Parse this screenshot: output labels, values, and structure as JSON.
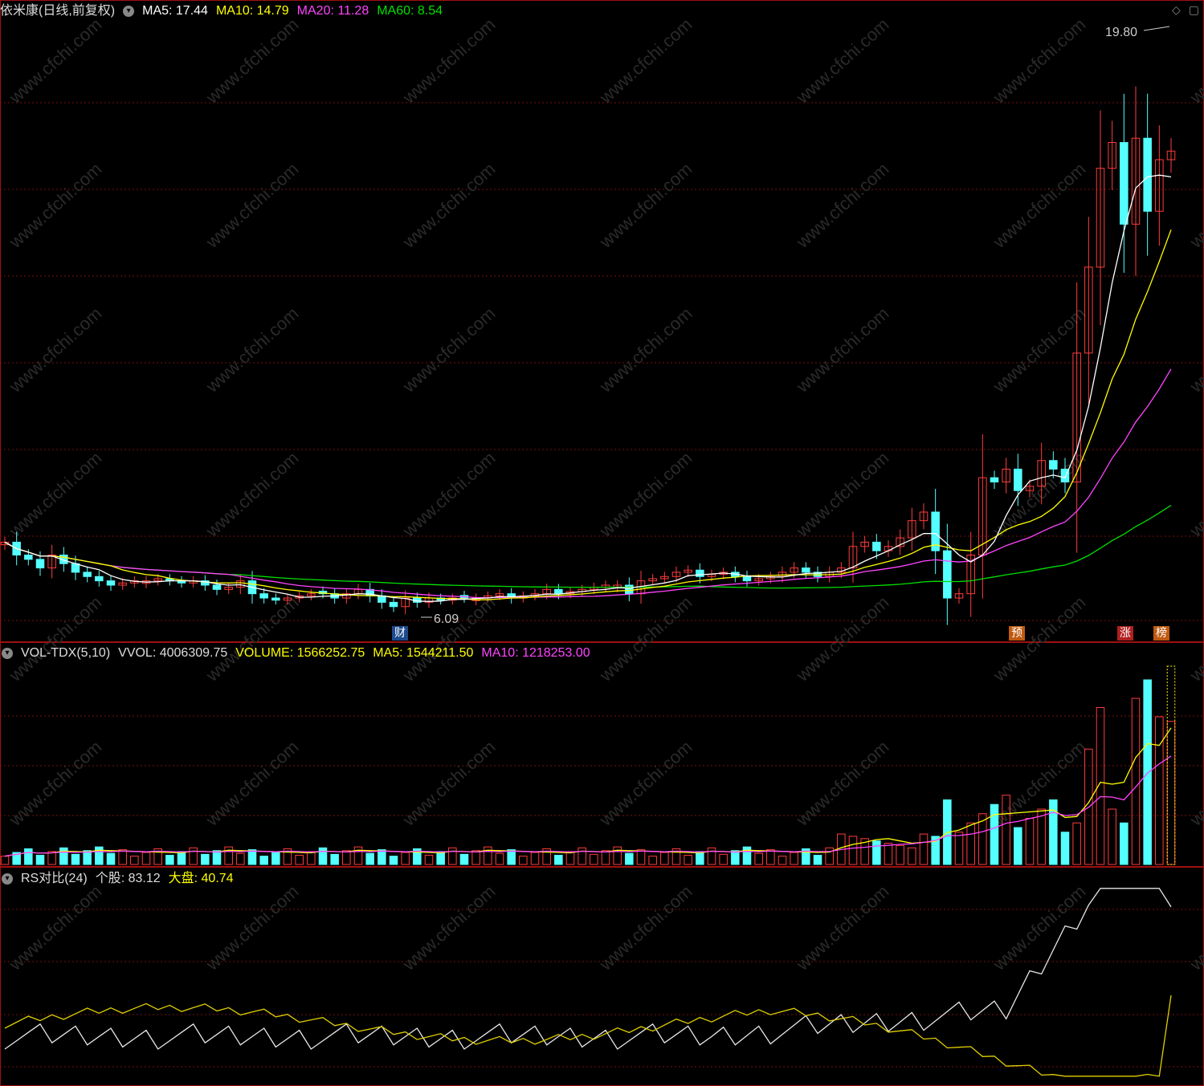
{
  "header": {
    "stock": "依米康(日线,前复权)",
    "ma5": "MA5: 17.44",
    "ma10": "MA10: 14.79",
    "ma20": "MA20: 11.28",
    "ma60": "MA60: 8.54"
  },
  "vol_header": {
    "name": "VOL-TDX(5,10)",
    "vvol": "VVOL: 4006309.75",
    "volume": "VOLUME: 1566252.75",
    "ma5": "MA5: 1544211.50",
    "ma10": "MA10: 1218253.00"
  },
  "rs_header": {
    "name": "RS对比(24)",
    "stock": "个股: 83.12",
    "market": "大盘: 40.74"
  },
  "annotations": {
    "high": "19.80",
    "low": "6.09",
    "tag_cai": "财",
    "tag_yu": "预",
    "tag_zhang": "涨",
    "tag_bang": "榜"
  },
  "watermark": "www.cfchi.com",
  "colors": {
    "up": "#ff3c3c",
    "down": "#54ffff",
    "ma5": "#ffffff",
    "ma10": "#ffff00",
    "ma20": "#ff44ff",
    "ma60": "#00e000",
    "grid": "#7a1010",
    "frame": "#a01010"
  },
  "chart_data": {
    "type": "candlestick",
    "closes": [
      7.8,
      7.5,
      7.4,
      7.2,
      7.5,
      7.3,
      7.1,
      7.0,
      6.9,
      6.8,
      6.85,
      6.9,
      6.9,
      6.95,
      6.9,
      6.85,
      6.9,
      6.8,
      6.7,
      6.75,
      6.9,
      6.6,
      6.5,
      6.45,
      6.5,
      6.55,
      6.6,
      6.6,
      6.5,
      6.6,
      6.7,
      6.55,
      6.4,
      6.3,
      6.5,
      6.4,
      6.5,
      6.45,
      6.5,
      6.5,
      6.5,
      6.55,
      6.6,
      6.5,
      6.55,
      6.6,
      6.7,
      6.6,
      6.65,
      6.7,
      6.75,
      6.8,
      6.8,
      6.6,
      6.9,
      6.95,
      7.0,
      7.1,
      7.15,
      7.0,
      7.05,
      7.1,
      7.0,
      6.9,
      6.95,
      7.0,
      7.1,
      7.2,
      7.1,
      7.0,
      7.1,
      7.2,
      7.7,
      7.8,
      7.6,
      7.7,
      7.9,
      8.3,
      8.5,
      7.6,
      6.5,
      6.6,
      7.5,
      9.3,
      9.2,
      9.5,
      9.0,
      9.1,
      9.7,
      9.5,
      9.2,
      12.2,
      14.2,
      16.5,
      17.1,
      15.2,
      17.2,
      15.5,
      16.7,
      16.9
    ],
    "ma5": "17.44",
    "volume_last": "1566252.75",
    "rs_stock_last": "83.12",
    "rs_market_last": "40.74",
    "price_high": 19.8,
    "price_low": 6.09
  }
}
